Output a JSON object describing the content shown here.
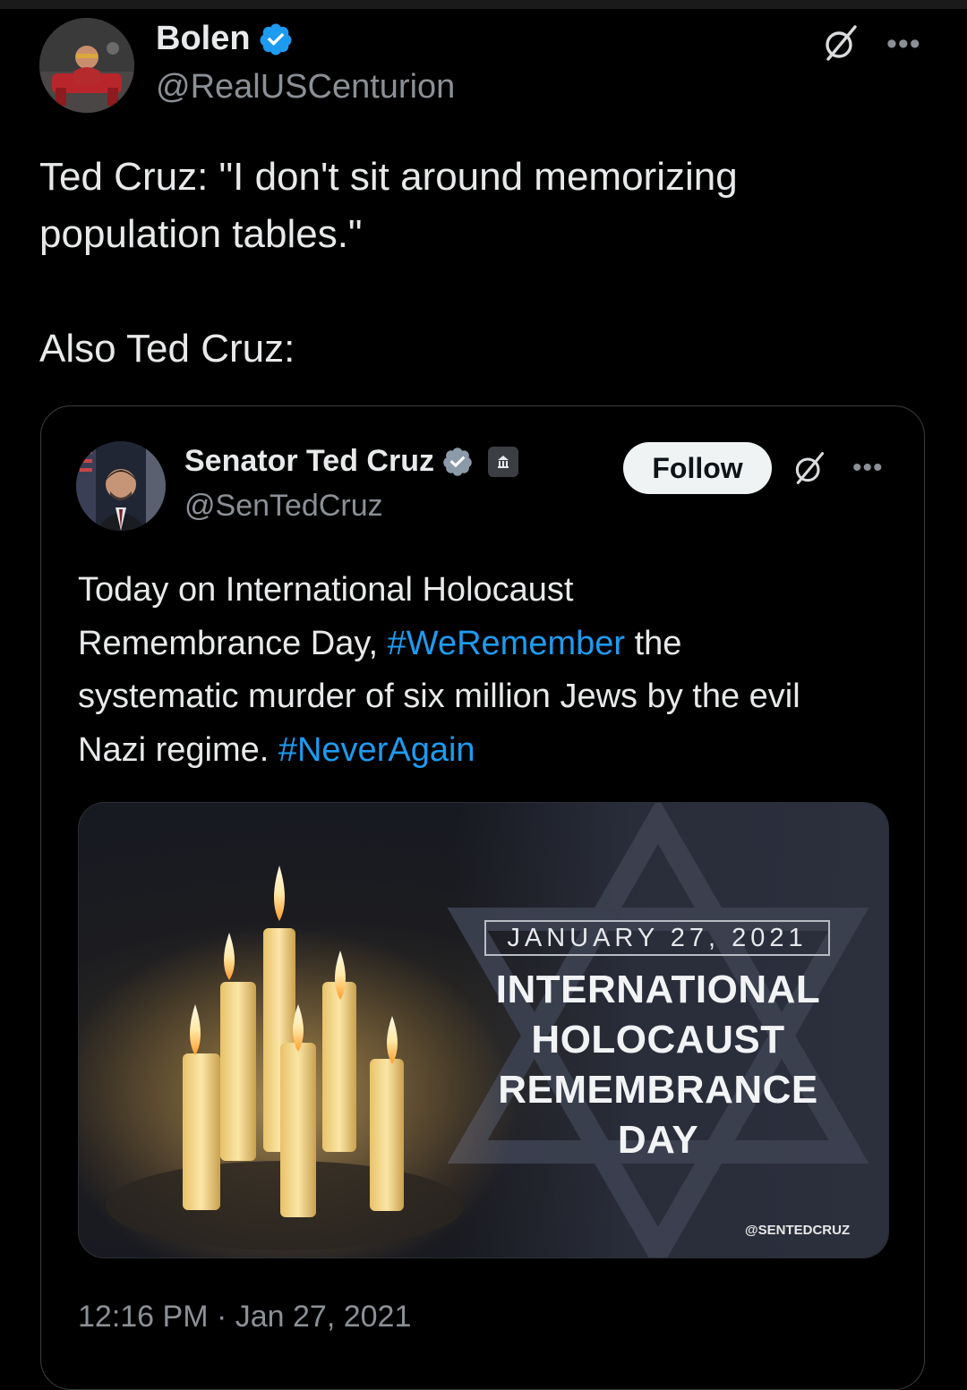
{
  "outer_tweet": {
    "author_name": "Bolen",
    "author_handle": "@RealUSCenturion",
    "text_lines": [
      "Ted Cruz: \"I don't sit around memorizing",
      "population tables.\"",
      "Also Ted Cruz:"
    ],
    "more_label": "•••"
  },
  "quoted_tweet": {
    "author_name": "Senator Ted Cruz",
    "author_handle": "@SenTedCruz",
    "follow_label": "Follow",
    "more_label": "•••",
    "text": {
      "part1": "Today on International Holocaust",
      "part2": "Remembrance Day, ",
      "hashtag1": "#WeRemember",
      "part3": " the",
      "part4": "systematic murder of six million Jews by the evil",
      "part5": "Nazi regime. ",
      "hashtag2": "#NeverAgain"
    },
    "media": {
      "date": "JANUARY 27, 2021",
      "title_lines": [
        "INTERNATIONAL",
        "HOLOCAUST",
        "REMEMBRANCE",
        "DAY"
      ],
      "credit": "@SENTEDCRUZ"
    },
    "timestamp": "12:16 PM · Jan 27, 2021"
  },
  "colors": {
    "background": "#000000",
    "text": "#e7e9ea",
    "secondary": "#8b9096",
    "link": "#1d9bf0",
    "verified": "#1d9bf0"
  }
}
